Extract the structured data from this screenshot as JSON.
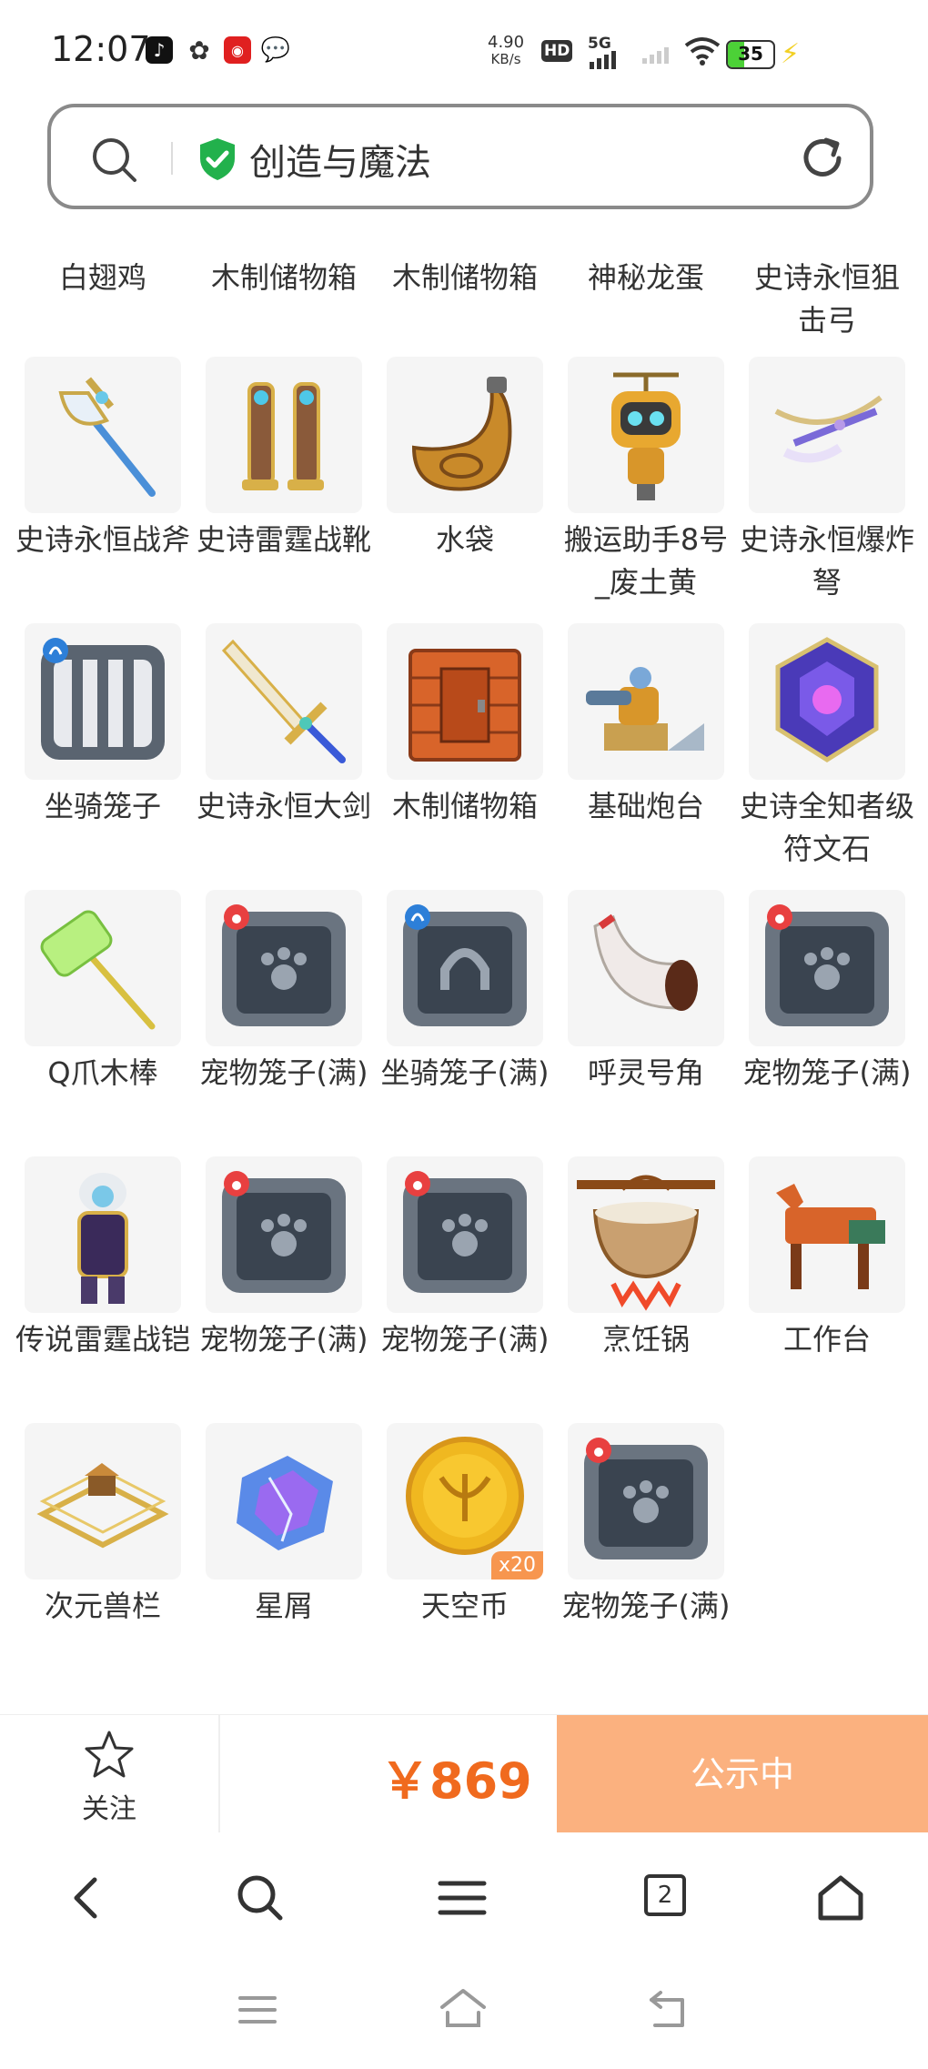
{
  "status_bar": {
    "time": "12:07",
    "net_speed_value": "4.90",
    "net_speed_unit": "KB/s",
    "hd": "HD",
    "network": "5G",
    "battery": "35",
    "apps": [
      "tiktok-icon",
      "pinwheel-icon",
      "red-app-icon",
      "wechat-icon"
    ]
  },
  "header": {
    "title": "创造与魔法",
    "icons": [
      "search-icon",
      "shield-check-icon",
      "refresh-icon"
    ]
  },
  "top_row_items": [
    "白翅鸡",
    "木制储物箱",
    "木制储物箱",
    "神秘龙蛋",
    "史诗永恒狙击弓"
  ],
  "items": [
    {
      "name": "史诗永恒战斧"
    },
    {
      "name": "史诗雷霆战靴"
    },
    {
      "name": "水袋"
    },
    {
      "name": "搬运助手8号_废土黄"
    },
    {
      "name": "史诗永恒爆炸弩"
    },
    {
      "name": "坐骑笼子"
    },
    {
      "name": "史诗永恒大剑"
    },
    {
      "name": "木制储物箱"
    },
    {
      "name": "基础炮台"
    },
    {
      "name": "史诗全知者级符文石"
    },
    {
      "name": "Q爪木棒"
    },
    {
      "name": "宠物笼子(满)"
    },
    {
      "name": "坐骑笼子(满)"
    },
    {
      "name": "呼灵号角"
    },
    {
      "name": "宠物笼子(满)"
    },
    {
      "name": "传说雷霆战铠"
    },
    {
      "name": "宠物笼子(满)"
    },
    {
      "name": "宠物笼子(满)"
    },
    {
      "name": "烹饪锅"
    },
    {
      "name": "工作台"
    },
    {
      "name": "次元兽栏"
    },
    {
      "name": "星屑"
    },
    {
      "name": "天空币",
      "qty": "x20"
    },
    {
      "name": "宠物笼子(满)"
    }
  ],
  "action_bar": {
    "follow_label": "关注",
    "price": "￥869",
    "status_label": "公示中",
    "accent": "#fbb17f",
    "price_color": "#f06a1e"
  },
  "browser_nav": {
    "tabs_count": "2",
    "icons": [
      "back-icon",
      "search-icon",
      "menu-icon",
      "tabs-icon",
      "home-icon"
    ]
  },
  "system_nav": {
    "icons": [
      "recent-apps-icon",
      "home-icon",
      "back-icon"
    ]
  }
}
